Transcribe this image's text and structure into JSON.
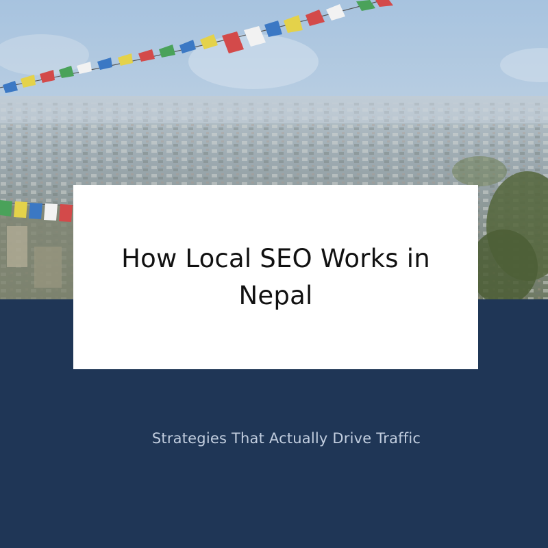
{
  "title": "How Local SEO Works in Nepal",
  "subtitle": "Strategies That Actually Drive Traffic",
  "colors": {
    "navy": "#1f3656",
    "subtitle_text": "#c2cedf",
    "card": "#ffffff",
    "sky_top": "#a9c4df",
    "haze": "#c9d6e1"
  }
}
